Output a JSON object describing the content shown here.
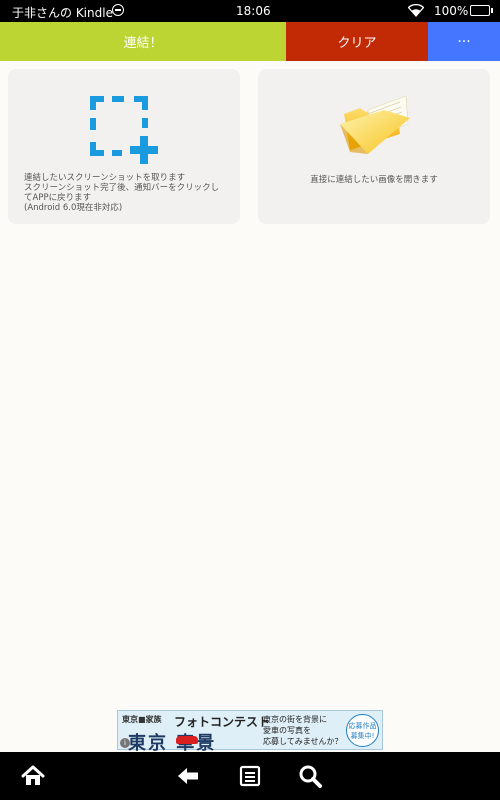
{
  "status_bar": {
    "owner": "于非さんの Kindle",
    "time": "18:06",
    "battery": "100%"
  },
  "toolbar": {
    "connect_label": "連結！",
    "clear_label": "クリア",
    "more_label": "···"
  },
  "cards": {
    "screenshot": {
      "description": "連結したいスクリーンショットを取ります\nスクリーンショット完了後、通知バーをクリックし\nてAPPに戻ります\n(Android 6.0現在非対応)",
      "icon": "screenshot-crop-icon"
    },
    "open_image": {
      "description": "直接に連結したい画像を開きます",
      "icon": "folder-icon"
    }
  },
  "ad": {
    "brand": "東京■家族",
    "headline": "フォトコンテスト",
    "title": "東京  車景",
    "body": "東京の街を背景に\n愛車の写真を\n応募してみませんか？",
    "badge": "応募作品\n募集中!",
    "info": "i"
  },
  "colors": {
    "connect": "#bdd532",
    "clear": "#c22a06",
    "more": "#4476ff",
    "icon_blue": "#1a9be0",
    "folder_yellow": "#f6c21a"
  },
  "nav": {
    "icons": [
      "home-icon",
      "back-arrow-icon",
      "menu-icon",
      "search-icon"
    ]
  }
}
